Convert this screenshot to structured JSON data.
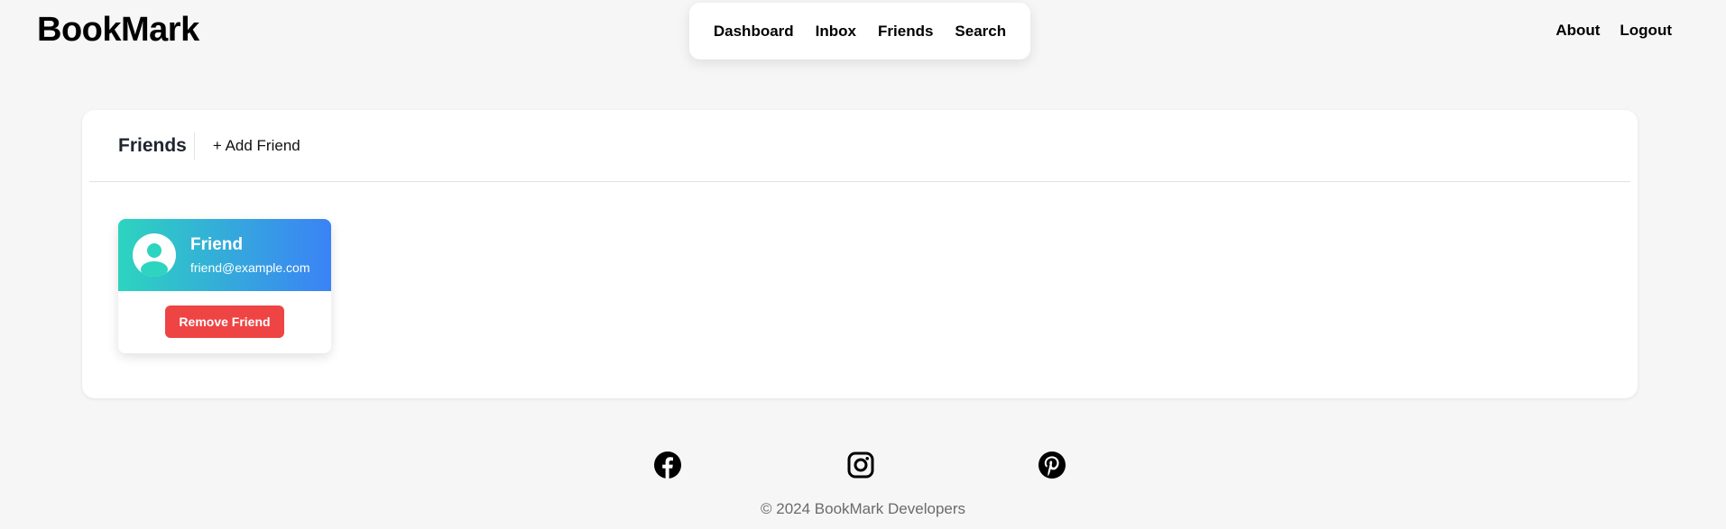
{
  "header": {
    "brand": "BookMark",
    "nav": [
      "Dashboard",
      "Inbox",
      "Friends",
      "Search"
    ],
    "aux": [
      "About",
      "Logout"
    ]
  },
  "friends_panel": {
    "title": "Friends",
    "add_label": "+ Add Friend",
    "friends": [
      {
        "name": "Friend",
        "email": "friend@example.com",
        "remove_label": "Remove Friend"
      }
    ]
  },
  "footer": {
    "social_icons": [
      "facebook-icon",
      "instagram-icon",
      "pinterest-icon"
    ],
    "copyright": "© 2024 BookMark Developers"
  },
  "colors": {
    "gradient_start": "#2dd4bf",
    "gradient_end": "#3b82f6",
    "danger": "#ef4444",
    "background": "#f6f6f6"
  }
}
